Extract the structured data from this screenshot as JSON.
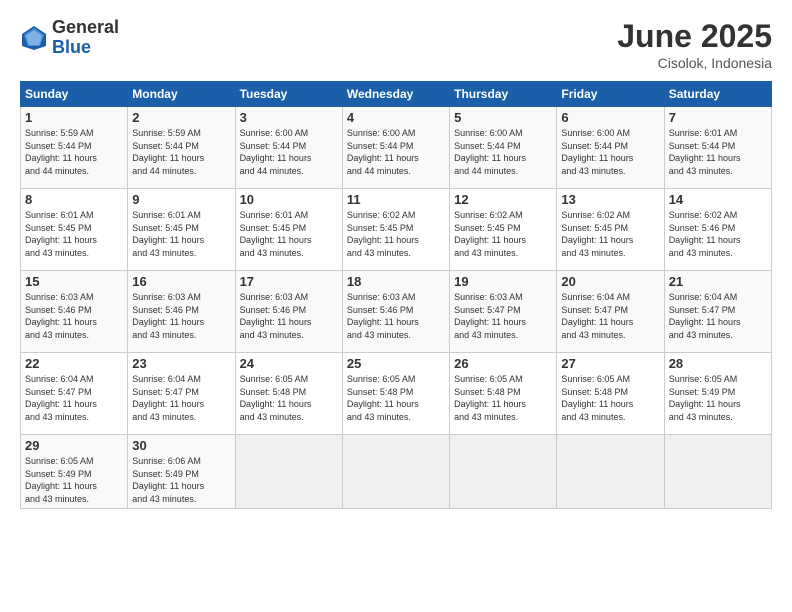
{
  "logo": {
    "general": "General",
    "blue": "Blue"
  },
  "title": "June 2025",
  "location": "Cisolok, Indonesia",
  "days_header": [
    "Sunday",
    "Monday",
    "Tuesday",
    "Wednesday",
    "Thursday",
    "Friday",
    "Saturday"
  ],
  "weeks": [
    [
      {
        "day": "1",
        "info": "Sunrise: 5:59 AM\nSunset: 5:44 PM\nDaylight: 11 hours\nand 44 minutes."
      },
      {
        "day": "2",
        "info": "Sunrise: 5:59 AM\nSunset: 5:44 PM\nDaylight: 11 hours\nand 44 minutes."
      },
      {
        "day": "3",
        "info": "Sunrise: 6:00 AM\nSunset: 5:44 PM\nDaylight: 11 hours\nand 44 minutes."
      },
      {
        "day": "4",
        "info": "Sunrise: 6:00 AM\nSunset: 5:44 PM\nDaylight: 11 hours\nand 44 minutes."
      },
      {
        "day": "5",
        "info": "Sunrise: 6:00 AM\nSunset: 5:44 PM\nDaylight: 11 hours\nand 44 minutes."
      },
      {
        "day": "6",
        "info": "Sunrise: 6:00 AM\nSunset: 5:44 PM\nDaylight: 11 hours\nand 43 minutes."
      },
      {
        "day": "7",
        "info": "Sunrise: 6:01 AM\nSunset: 5:44 PM\nDaylight: 11 hours\nand 43 minutes."
      }
    ],
    [
      {
        "day": "8",
        "info": "Sunrise: 6:01 AM\nSunset: 5:45 PM\nDaylight: 11 hours\nand 43 minutes."
      },
      {
        "day": "9",
        "info": "Sunrise: 6:01 AM\nSunset: 5:45 PM\nDaylight: 11 hours\nand 43 minutes."
      },
      {
        "day": "10",
        "info": "Sunrise: 6:01 AM\nSunset: 5:45 PM\nDaylight: 11 hours\nand 43 minutes."
      },
      {
        "day": "11",
        "info": "Sunrise: 6:02 AM\nSunset: 5:45 PM\nDaylight: 11 hours\nand 43 minutes."
      },
      {
        "day": "12",
        "info": "Sunrise: 6:02 AM\nSunset: 5:45 PM\nDaylight: 11 hours\nand 43 minutes."
      },
      {
        "day": "13",
        "info": "Sunrise: 6:02 AM\nSunset: 5:45 PM\nDaylight: 11 hours\nand 43 minutes."
      },
      {
        "day": "14",
        "info": "Sunrise: 6:02 AM\nSunset: 5:46 PM\nDaylight: 11 hours\nand 43 minutes."
      }
    ],
    [
      {
        "day": "15",
        "info": "Sunrise: 6:03 AM\nSunset: 5:46 PM\nDaylight: 11 hours\nand 43 minutes."
      },
      {
        "day": "16",
        "info": "Sunrise: 6:03 AM\nSunset: 5:46 PM\nDaylight: 11 hours\nand 43 minutes."
      },
      {
        "day": "17",
        "info": "Sunrise: 6:03 AM\nSunset: 5:46 PM\nDaylight: 11 hours\nand 43 minutes."
      },
      {
        "day": "18",
        "info": "Sunrise: 6:03 AM\nSunset: 5:46 PM\nDaylight: 11 hours\nand 43 minutes."
      },
      {
        "day": "19",
        "info": "Sunrise: 6:03 AM\nSunset: 5:47 PM\nDaylight: 11 hours\nand 43 minutes."
      },
      {
        "day": "20",
        "info": "Sunrise: 6:04 AM\nSunset: 5:47 PM\nDaylight: 11 hours\nand 43 minutes."
      },
      {
        "day": "21",
        "info": "Sunrise: 6:04 AM\nSunset: 5:47 PM\nDaylight: 11 hours\nand 43 minutes."
      }
    ],
    [
      {
        "day": "22",
        "info": "Sunrise: 6:04 AM\nSunset: 5:47 PM\nDaylight: 11 hours\nand 43 minutes."
      },
      {
        "day": "23",
        "info": "Sunrise: 6:04 AM\nSunset: 5:47 PM\nDaylight: 11 hours\nand 43 minutes."
      },
      {
        "day": "24",
        "info": "Sunrise: 6:05 AM\nSunset: 5:48 PM\nDaylight: 11 hours\nand 43 minutes."
      },
      {
        "day": "25",
        "info": "Sunrise: 6:05 AM\nSunset: 5:48 PM\nDaylight: 11 hours\nand 43 minutes."
      },
      {
        "day": "26",
        "info": "Sunrise: 6:05 AM\nSunset: 5:48 PM\nDaylight: 11 hours\nand 43 minutes."
      },
      {
        "day": "27",
        "info": "Sunrise: 6:05 AM\nSunset: 5:48 PM\nDaylight: 11 hours\nand 43 minutes."
      },
      {
        "day": "28",
        "info": "Sunrise: 6:05 AM\nSunset: 5:49 PM\nDaylight: 11 hours\nand 43 minutes."
      }
    ],
    [
      {
        "day": "29",
        "info": "Sunrise: 6:05 AM\nSunset: 5:49 PM\nDaylight: 11 hours\nand 43 minutes."
      },
      {
        "day": "30",
        "info": "Sunrise: 6:06 AM\nSunset: 5:49 PM\nDaylight: 11 hours\nand 43 minutes."
      },
      {
        "day": "",
        "info": ""
      },
      {
        "day": "",
        "info": ""
      },
      {
        "day": "",
        "info": ""
      },
      {
        "day": "",
        "info": ""
      },
      {
        "day": "",
        "info": ""
      }
    ]
  ]
}
